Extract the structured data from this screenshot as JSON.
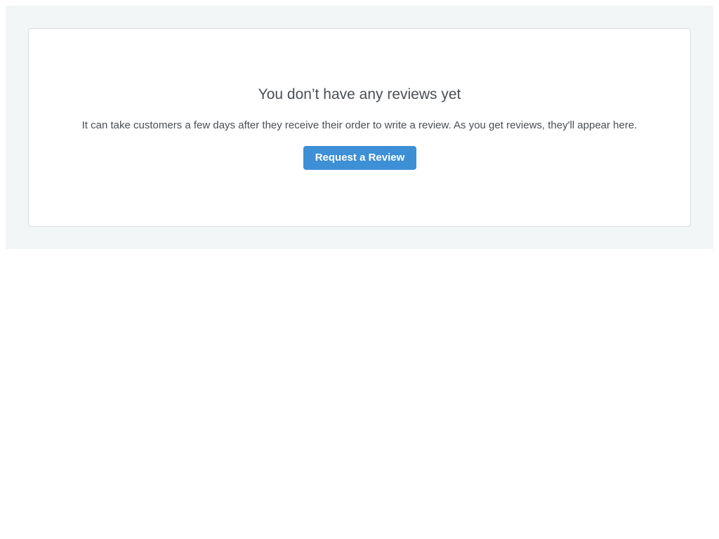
{
  "empty_state": {
    "title": "You don’t have any reviews yet",
    "description": "It can take customers a few days after they receive their order to write a review. As you get reviews, they'll appear here.",
    "button_label": "Request a Review"
  },
  "colors": {
    "accent": "#3d8fd6",
    "panel_background": "#f3f6f7",
    "text": "#4a4f54"
  }
}
